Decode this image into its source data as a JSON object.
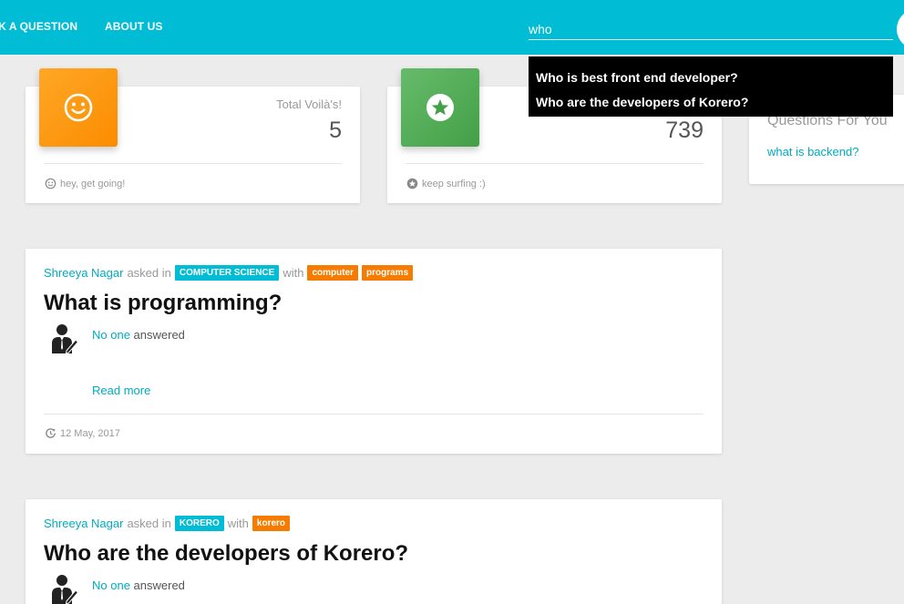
{
  "nav": {
    "ask_label": "SK A QUESTION",
    "about_label": "ABOUT US"
  },
  "search": {
    "value": "who",
    "suggestions": [
      "Who is best front end developer?",
      "Who are the developers of Korero?"
    ]
  },
  "stats": [
    {
      "label": "Total Voilà's!",
      "value": "5",
      "footer": "hey, get going!",
      "icon": "smiley-icon",
      "color": "#fb8c00"
    },
    {
      "label": "",
      "value": "739",
      "footer": "keep surfing :)",
      "icon": "star-icon",
      "color": "#43a047"
    }
  ],
  "sidebar": {
    "title": "Questions For You",
    "link": "what is backend?"
  },
  "questions": [
    {
      "author": "Shreeya Nagar",
      "asked_in": "asked in",
      "category": "COMPUTER SCIENCE",
      "with": "with",
      "tags": [
        "computer",
        "programs"
      ],
      "title": "What is programming?",
      "answered_by": "No one",
      "answered": "answered",
      "read_more": "Read more",
      "date": "12 May, 2017"
    },
    {
      "author": "Shreeya Nagar",
      "asked_in": "asked in",
      "category": "KORERO",
      "with": "with",
      "tags": [
        "korero"
      ],
      "title": "Who are the developers of Korero?",
      "answered_by": "No one",
      "answered": "answered"
    }
  ],
  "colors": {
    "primary": "#00bcd4",
    "link": "#00acc1",
    "tag": "#f57c00"
  }
}
